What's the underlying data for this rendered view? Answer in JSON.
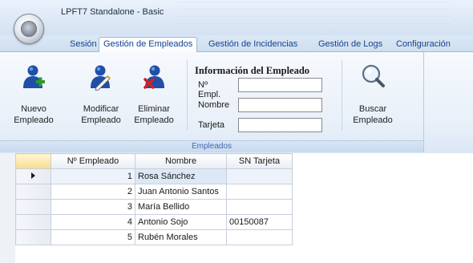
{
  "window": {
    "title": "LPFT7 Standalone - Basic"
  },
  "tabs": [
    {
      "label": "Sesión",
      "active": false
    },
    {
      "label": "Gestión de Empleados",
      "active": true
    },
    {
      "label": "Gestión de Incidencias",
      "active": false
    },
    {
      "label": "Gestión de Logs",
      "active": false
    },
    {
      "label": "Configuración",
      "active": false
    }
  ],
  "ribbon": {
    "group_label": "Empleados",
    "buttons": {
      "nuevo": {
        "label": "Nuevo\nEmpleado",
        "icon": "person-add-icon"
      },
      "modificar": {
        "label": "Modificar\nEmpleado",
        "icon": "person-edit-icon"
      },
      "eliminar": {
        "label": "Eliminar\nEmpleado",
        "icon": "person-delete-icon"
      },
      "buscar": {
        "label": "Buscar\nEmpleado",
        "icon": "magnifier-icon"
      }
    },
    "info": {
      "title": "Información del Empleado",
      "fields": [
        {
          "label": "Nº Empl.",
          "value": ""
        },
        {
          "label": "Nombre",
          "value": ""
        },
        {
          "label": "Tarjeta",
          "value": ""
        }
      ]
    }
  },
  "grid": {
    "columns": [
      "Nº Empleado",
      "Nombre",
      "SN Tarjeta"
    ],
    "rows": [
      {
        "num": "1",
        "name": "Rosa Sánchez",
        "card": "",
        "current": true
      },
      {
        "num": "2",
        "name": "Juan Antonio Santos",
        "card": ""
      },
      {
        "num": "3",
        "name": "María Bellido",
        "card": ""
      },
      {
        "num": "4",
        "name": "Antonio Sojo",
        "card": "00150087"
      },
      {
        "num": "5",
        "name": "Rubén Morales",
        "card": ""
      }
    ]
  },
  "colors": {
    "accent": "#15428b",
    "ribbon_bg": "#e9f0f9",
    "add": "#2e9a2e",
    "delete": "#d42020",
    "user": "#1f4fa8"
  }
}
